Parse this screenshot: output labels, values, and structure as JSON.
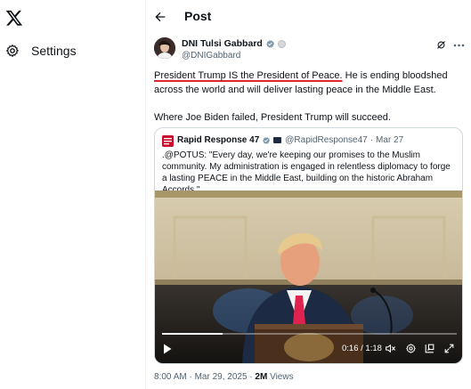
{
  "nav": {
    "logo_icon": "x-logo-icon",
    "settings_label": "Settings",
    "settings_icon": "gear-icon"
  },
  "header": {
    "title": "Post",
    "back_icon": "arrow-left-icon"
  },
  "post": {
    "author_name": "DNI Tulsi Gabbard",
    "author_handle": "@DNIGabbard",
    "verified_color": "#829aab",
    "text_underlined": "President Trump IS the President of Peace.",
    "text_rest": " He is ending bloodshed across the world and will deliver lasting peace in the Middle East.",
    "text_second": "Where Joe Biden failed, President Trump will succeed.",
    "timestamp": "8:00 AM · Mar 29, 2025 · ",
    "views_count": "2M",
    "views_label": " Views"
  },
  "quote": {
    "author_name": "Rapid Response 47",
    "author_handle": "@RapidResponse47",
    "separator": "·",
    "date": "Mar 27",
    "text": ".@POTUS: \"Every day, we're keeping our promises to the Muslim community. My administration is engaged in relentless diplomacy to forge a lasting PEACE in the Middle East, building on the historic Abraham Accords.\"",
    "brand_color": "#c8102e"
  },
  "video": {
    "time": "0:16 / 1:18",
    "progress": 0.205
  },
  "colors": {
    "accent_red": "#e0282e",
    "text_primary": "#0f1419",
    "text_secondary": "#536471",
    "border": "#cfd9de"
  }
}
